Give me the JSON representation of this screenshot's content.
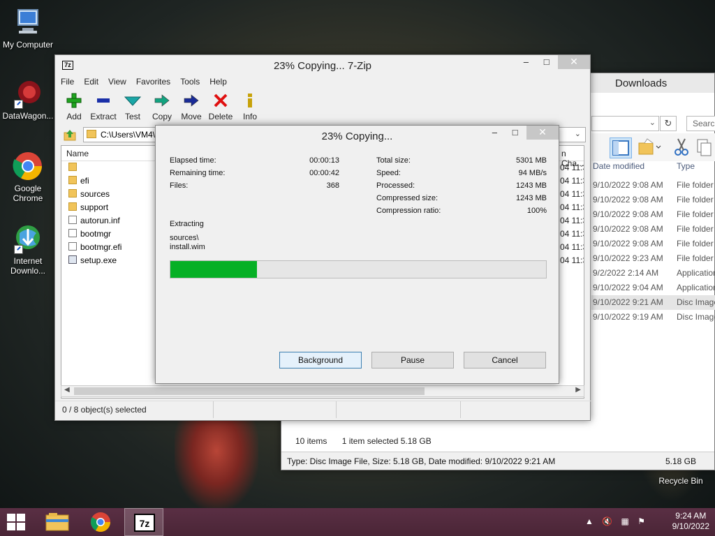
{
  "desktop": {
    "icons": [
      {
        "label": "My Computer"
      },
      {
        "label": "DataWagon..."
      },
      {
        "label": "Google Chrome"
      },
      {
        "label": "Internet Downlo..."
      },
      {
        "label": "Recycle Bin"
      }
    ]
  },
  "explorer": {
    "title": "Downloads",
    "search_placeholder": "Search",
    "columns": {
      "date": "Date modified",
      "type": "Type"
    },
    "rows": [
      {
        "date": "9/10/2022 9:08 AM",
        "type": "File folder",
        "selected": false
      },
      {
        "date": "9/10/2022 9:08 AM",
        "type": "File folder",
        "selected": false
      },
      {
        "date": "9/10/2022 9:08 AM",
        "type": "File folder",
        "selected": false
      },
      {
        "date": "9/10/2022 9:08 AM",
        "type": "File folder",
        "selected": false
      },
      {
        "date": "9/10/2022 9:08 AM",
        "type": "File folder",
        "selected": false
      },
      {
        "date": "9/10/2022 9:23 AM",
        "type": "File folder",
        "selected": false
      },
      {
        "date": "9/2/2022 2:14 AM",
        "type": "Application",
        "selected": false
      },
      {
        "date": "9/10/2022 9:04 AM",
        "type": "Application",
        "selected": false
      },
      {
        "date": "9/10/2022 9:21 AM",
        "type": "Disc Image",
        "selected": true
      },
      {
        "date": "9/10/2022 9:19 AM",
        "type": "Disc Image",
        "selected": false
      }
    ],
    "status": {
      "items": "10 items",
      "selected": "1 item selected  5.18 GB"
    },
    "details": {
      "text": "Type: Disc Image File, Size: 5.18 GB, Date modified: 9/10/2022 9:21 AM",
      "size": "5.18 GB"
    }
  },
  "sevenzip": {
    "logo": "7z",
    "title": "23% Copying... 7-Zip",
    "menu": [
      "File",
      "Edit",
      "View",
      "Favorites",
      "Tools",
      "Help"
    ],
    "toolbar": [
      {
        "label": "Add",
        "icon": "plus-icon",
        "color": "#1fa51f"
      },
      {
        "label": "Extract",
        "icon": "minus-icon",
        "color": "#1a2fa8"
      },
      {
        "label": "Test",
        "icon": "check-icon",
        "color": "#1aa6a6"
      },
      {
        "label": "Copy",
        "icon": "arrow-right-icon",
        "color": "#12a380"
      },
      {
        "label": "Move",
        "icon": "arrow-right-icon",
        "color": "#1a2c98"
      },
      {
        "label": "Delete",
        "icon": "x-icon",
        "color": "#e01010"
      },
      {
        "label": "Info",
        "icon": "info-icon",
        "color": "#c7a20a"
      }
    ],
    "path": "C:\\Users\\VM4\\",
    "list": {
      "name_header": "Name",
      "right_header": "n Cha...",
      "files": [
        {
          "name": "",
          "kind": "folder",
          "date": "04 11:3"
        },
        {
          "name": "efi",
          "kind": "folder",
          "date": "04 11:3"
        },
        {
          "name": "sources",
          "kind": "folder",
          "date": "04 11:3"
        },
        {
          "name": "support",
          "kind": "folder",
          "date": "04 11:3"
        },
        {
          "name": "autorun.inf",
          "kind": "file",
          "date": "04 11:3"
        },
        {
          "name": "bootmgr",
          "kind": "file",
          "date": "04 11:3"
        },
        {
          "name": "bootmgr.efi",
          "kind": "file",
          "date": "04 11:3"
        },
        {
          "name": "setup.exe",
          "kind": "exe",
          "date": "04 11:3"
        }
      ]
    },
    "status": "0 / 8 object(s) selected"
  },
  "progress": {
    "title": "23% Copying...",
    "left_stats": [
      {
        "label": "Elapsed time:",
        "value": "00:00:13"
      },
      {
        "label": "Remaining time:",
        "value": "00:00:42"
      },
      {
        "label": "Files:",
        "value": "368"
      }
    ],
    "right_stats": [
      {
        "label": "Total size:",
        "value": "5301 MB"
      },
      {
        "label": "Speed:",
        "value": "94 MB/s"
      },
      {
        "label": "Processed:",
        "value": "1243 MB"
      },
      {
        "label": "Compressed size:",
        "value": "1243 MB"
      },
      {
        "label": "Compression ratio:",
        "value": "100%"
      }
    ],
    "operation": "Extracting",
    "current_path": "sources\\",
    "current_file": "install.wim",
    "percent": 23,
    "buttons": {
      "background": "Background",
      "pause": "Pause",
      "cancel": "Cancel"
    }
  },
  "taskbar": {
    "time": "9:24 AM",
    "date": "9/10/2022"
  },
  "colors": {
    "progress_fill": "#06b025",
    "taskbar": "#4a2536"
  }
}
